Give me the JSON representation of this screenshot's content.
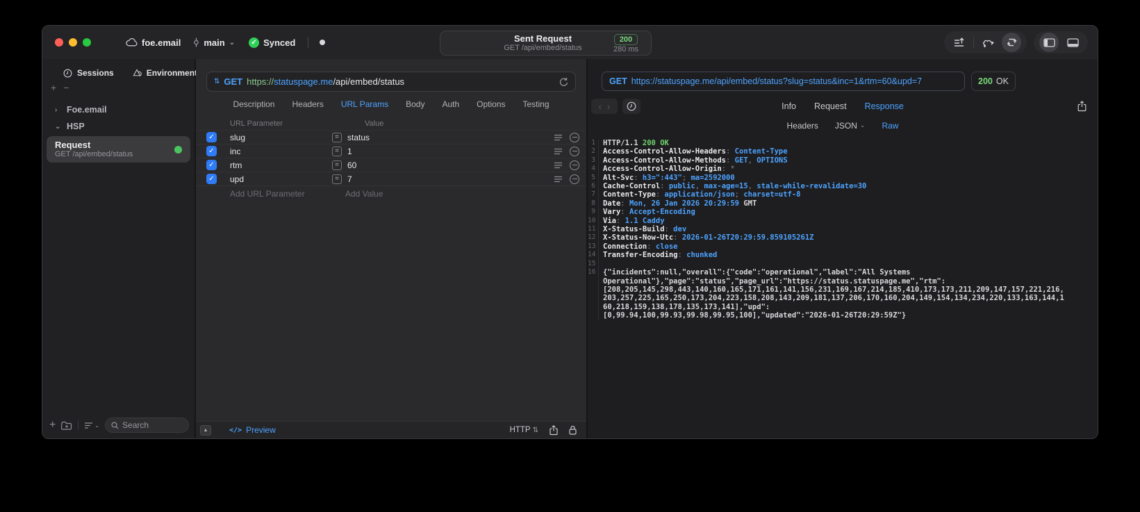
{
  "titlebar": {
    "project": "foe.email",
    "branch": "main",
    "sync_status": "Synced",
    "request_title": "Sent Request",
    "request_subtitle": "GET /api/embed/status",
    "status_code": "200",
    "duration": "280 ms"
  },
  "sidebar": {
    "tabs": [
      {
        "id": "sessions",
        "label": "Sessions",
        "icon": "clock-icon"
      },
      {
        "id": "environments",
        "label": "Environments",
        "icon": "shapes-icon"
      }
    ],
    "active_tab": "Sessions",
    "tree": [
      {
        "label": "Foe.email",
        "expanded": false
      },
      {
        "label": "HSP",
        "expanded": true
      }
    ],
    "request_item": {
      "title": "Request",
      "subtitle": "GET /api/embed/status",
      "status_color": "#4cc45e"
    },
    "search_placeholder": "Search"
  },
  "request_editor": {
    "method": "GET",
    "url": {
      "scheme": "https://",
      "host": "statuspage.me",
      "path": "/api/embed/status"
    },
    "tabs": [
      "Description",
      "Headers",
      "URL Params",
      "Body",
      "Auth",
      "Options",
      "Testing"
    ],
    "active_tab": "URL Params",
    "table": {
      "name_header": "URL Parameter",
      "value_header": "Value",
      "rows": [
        {
          "enabled": true,
          "name": "slug",
          "value": "status"
        },
        {
          "enabled": true,
          "name": "inc",
          "value": "1"
        },
        {
          "enabled": true,
          "name": "rtm",
          "value": "60"
        },
        {
          "enabled": true,
          "name": "upd",
          "value": "7"
        }
      ],
      "add_name_label": "Add URL Parameter",
      "add_value_label": "Add Value"
    },
    "statusbar": {
      "code_glyph": "</>",
      "preview_label": "Preview",
      "protocol": "HTTP"
    }
  },
  "response_viewer": {
    "method": "GET",
    "url": "https://statuspage.me/api/embed/status?slug=status&inc=1&rtm=60&upd=7",
    "status_code": "200",
    "status_text": "OK",
    "tabs": [
      "Info",
      "Request",
      "Response"
    ],
    "active_tab": "Response",
    "subtabs": [
      "Headers",
      "JSON",
      "Raw"
    ],
    "active_subtab": "Raw",
    "lines": [
      {
        "num": "1",
        "segs": [
          [
            "plain",
            "HTTP/1.1 "
          ],
          [
            "green",
            "200 OK"
          ]
        ]
      },
      {
        "num": "2",
        "segs": [
          [
            "key",
            "Access-Control-Allow-Headers"
          ],
          [
            "dim",
            ": "
          ],
          [
            "val",
            "Content-Type"
          ]
        ]
      },
      {
        "num": "3",
        "segs": [
          [
            "key",
            "Access-Control-Allow-Methods"
          ],
          [
            "dim",
            ": "
          ],
          [
            "val",
            "GET"
          ],
          [
            "dim",
            ", "
          ],
          [
            "val",
            "OPTIONS"
          ]
        ]
      },
      {
        "num": "4",
        "segs": [
          [
            "key",
            "Access-Control-Allow-Origin"
          ],
          [
            "dim",
            ": "
          ],
          [
            "dim",
            "*"
          ]
        ]
      },
      {
        "num": "5",
        "segs": [
          [
            "key",
            "Alt-Svc"
          ],
          [
            "dim",
            ": "
          ],
          [
            "val",
            "h3=\":443\""
          ],
          [
            "dim",
            "; "
          ],
          [
            "val",
            "ma=2592000"
          ]
        ]
      },
      {
        "num": "6",
        "segs": [
          [
            "key",
            "Cache-Control"
          ],
          [
            "dim",
            ": "
          ],
          [
            "val",
            "public"
          ],
          [
            "dim",
            ", "
          ],
          [
            "val",
            "max-age=15"
          ],
          [
            "dim",
            ", "
          ],
          [
            "val",
            "stale-while-revalidate=30"
          ]
        ]
      },
      {
        "num": "7",
        "segs": [
          [
            "key",
            "Content-Type"
          ],
          [
            "dim",
            ": "
          ],
          [
            "val",
            "application/json"
          ],
          [
            "dim",
            "; "
          ],
          [
            "val",
            "charset=utf-8"
          ]
        ]
      },
      {
        "num": "8",
        "segs": [
          [
            "key",
            "Date"
          ],
          [
            "dim",
            ": "
          ],
          [
            "val",
            "Mon, 26 Jan 2026 20:29:59 "
          ],
          [
            "plain",
            "GMT"
          ]
        ]
      },
      {
        "num": "9",
        "segs": [
          [
            "key",
            "Vary"
          ],
          [
            "dim",
            ": "
          ],
          [
            "val",
            "Accept-Encoding"
          ]
        ]
      },
      {
        "num": "10",
        "segs": [
          [
            "key",
            "Via"
          ],
          [
            "dim",
            ": "
          ],
          [
            "val",
            "1.1 Caddy"
          ]
        ]
      },
      {
        "num": "11",
        "segs": [
          [
            "key",
            "X-Status-Build"
          ],
          [
            "dim",
            ": "
          ],
          [
            "val",
            "dev"
          ]
        ]
      },
      {
        "num": "12",
        "segs": [
          [
            "key",
            "X-Status-Now-Utc"
          ],
          [
            "dim",
            ": "
          ],
          [
            "val",
            "2026-01-26T20:29:59.859105261Z"
          ]
        ]
      },
      {
        "num": "13",
        "segs": [
          [
            "key",
            "Connection"
          ],
          [
            "dim",
            ": "
          ],
          [
            "val",
            "close"
          ]
        ]
      },
      {
        "num": "14",
        "segs": [
          [
            "key",
            "Transfer-Encoding"
          ],
          [
            "dim",
            ": "
          ],
          [
            "val",
            "chunked"
          ]
        ]
      },
      {
        "num": "15",
        "segs": []
      },
      {
        "num": "16",
        "segs": [
          [
            "plain",
            "{\"incidents\":null,\"overall\":{\"code\":\"operational\",\"label\":\"All Systems"
          ]
        ]
      },
      {
        "num": "",
        "segs": [
          [
            "plain",
            "Operational\"},\"page\":\"status\",\"page_url\":\"https://status.statuspage.me\",\"rtm\":"
          ]
        ]
      },
      {
        "num": "",
        "segs": [
          [
            "plain",
            "[208,205,145,298,443,140,160,165,171,161,141,156,231,169,167,214,185,410,173,173,211,209,147,157,221,216,"
          ]
        ]
      },
      {
        "num": "",
        "segs": [
          [
            "plain",
            "203,257,225,165,250,173,204,223,158,208,143,209,181,137,206,170,160,204,149,154,134,234,220,133,163,144,1"
          ]
        ]
      },
      {
        "num": "",
        "segs": [
          [
            "plain",
            "60,218,159,138,178,135,173,141],\"upd\":"
          ]
        ]
      },
      {
        "num": "",
        "segs": [
          [
            "plain",
            "[0,99.94,100,99.93,99.98,99.95,100],\"updated\":\"2026-01-26T20:29:59Z\"}"
          ]
        ]
      }
    ]
  },
  "colors": {
    "accent_blue": "#4da3ff",
    "success_green": "#6fd26f",
    "checkbox_blue": "#2f7cf6"
  }
}
